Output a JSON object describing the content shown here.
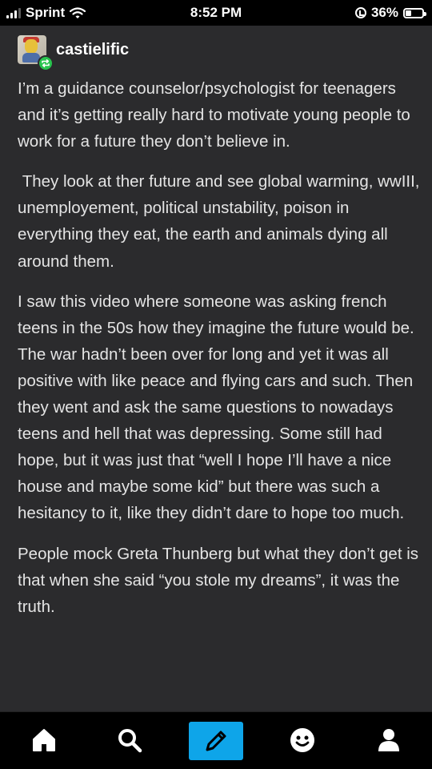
{
  "status_bar": {
    "carrier": "Sprint",
    "time": "8:52 PM",
    "battery_percent": "36%",
    "battery_level": 0.36
  },
  "post": {
    "username": "castielific",
    "avatar_badge_icon": "reblog-icon",
    "paragraphs": [
      "I’m a guidance counselor/psychologist for teenagers and it’s getting really hard to motivate young people to work for a future they don’t believe in.",
      " They look at ther future and see global warming, wwIII, unemployement, political unstability, poison in everything  they eat, the earth and animals dying all around them.",
      "I saw this video where someone was asking french teens in the 50s how they imagine the future would be. The war hadn’t been over for long and yet it was all positive with like peace and flying cars and such. Then they went and ask the same questions to nowadays teens and hell that was depressing. Some still had hope, but it was just that “well I hope I’ll have a nice house and maybe some kid” but there was such a hesitancy to it, like they didn’t dare to hope too much.",
      "People mock Greta Thunberg but what they don’t get is that when she said “you stole my dreams”, it was the truth."
    ]
  },
  "tab_bar": {
    "items": [
      "home-icon",
      "search-icon",
      "compose-icon",
      "activity-icon",
      "account-icon"
    ],
    "accent_color": "#0ea5e9"
  },
  "colors": {
    "post_background": "#2b2b2d",
    "bar_background": "#000000",
    "text": "#e4e4e4",
    "badge_green": "#28c44e"
  }
}
